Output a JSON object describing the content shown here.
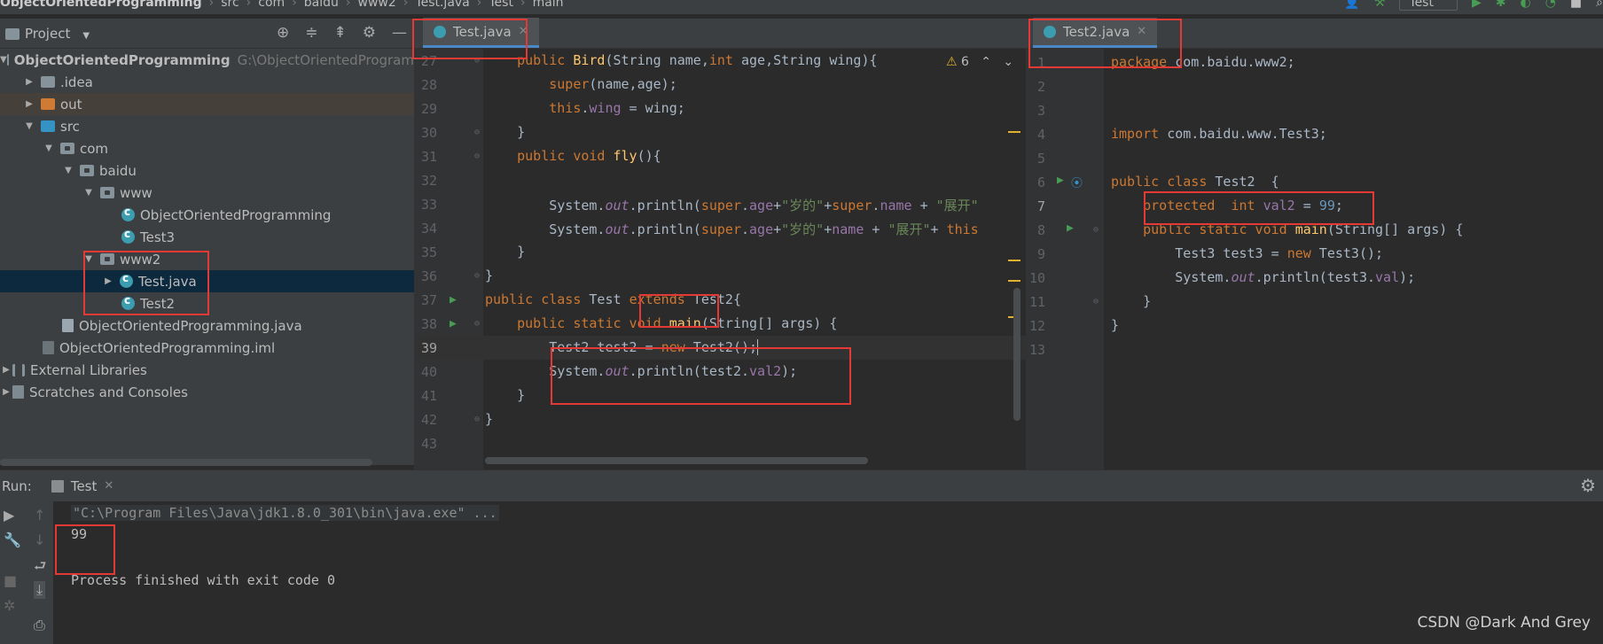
{
  "breadcrumb": {
    "items": [
      "ObjectOrientedProgramming",
      "src",
      "com",
      "baidu",
      "www2",
      "Test.java",
      "Test",
      "main"
    ],
    "run_config": "Test"
  },
  "project_panel": {
    "title": "Project",
    "tree": [
      {
        "label": "ObjectOrientedProgramming",
        "path": "G:\\ObjectOrientedProgram",
        "icon": "module-folder-icon"
      },
      {
        "label": ".idea",
        "icon": "folder-icon"
      },
      {
        "label": "out",
        "icon": "folder-orange-icon"
      },
      {
        "label": "src",
        "icon": "folder-blue-icon"
      },
      {
        "label": "com",
        "icon": "package-icon"
      },
      {
        "label": "baidu",
        "icon": "package-icon"
      },
      {
        "label": "www",
        "icon": "package-icon"
      },
      {
        "label": "ObjectOrientedProgramming",
        "icon": "class-icon"
      },
      {
        "label": "Test3",
        "icon": "class-icon"
      },
      {
        "label": "www2",
        "icon": "package-icon"
      },
      {
        "label": "Test.java",
        "icon": "class-icon"
      },
      {
        "label": "Test2",
        "icon": "class-icon"
      },
      {
        "label": "ObjectOrientedProgramming.java",
        "icon": "java-file-icon"
      },
      {
        "label": "ObjectOrientedProgramming.iml",
        "icon": "iml-file-icon"
      },
      {
        "label": "External Libraries",
        "icon": "library-icon"
      },
      {
        "label": "Scratches and Consoles",
        "icon": "scratch-icon"
      }
    ]
  },
  "editor_left": {
    "tab": "Test.java",
    "warnings": "6",
    "line_numbers": [
      "27",
      "28",
      "29",
      "30",
      "31",
      "32",
      "33",
      "34",
      "35",
      "36",
      "37",
      "38",
      "39",
      "40",
      "41",
      "42",
      "43"
    ]
  },
  "editor_right": {
    "tab": "Test2.java",
    "line_numbers": [
      "1",
      "2",
      "3",
      "4",
      "5",
      "6",
      "7",
      "8",
      "9",
      "10",
      "11",
      "12",
      "13"
    ]
  },
  "run_panel": {
    "label": "Run:",
    "tab": "Test",
    "output": {
      "command": "\"C:\\Program Files\\Java\\jdk1.8.0_301\\bin\\java.exe\" ...",
      "result": "99",
      "finished": "Process finished with exit code 0"
    }
  },
  "watermark": "CSDN @Dark And Grey",
  "colors": {
    "keyword": "#cc7832",
    "string": "#6a8759",
    "field": "#9876aa",
    "method": "#ffc66d",
    "number": "#6897bb",
    "highlight_box": "#e53935"
  }
}
